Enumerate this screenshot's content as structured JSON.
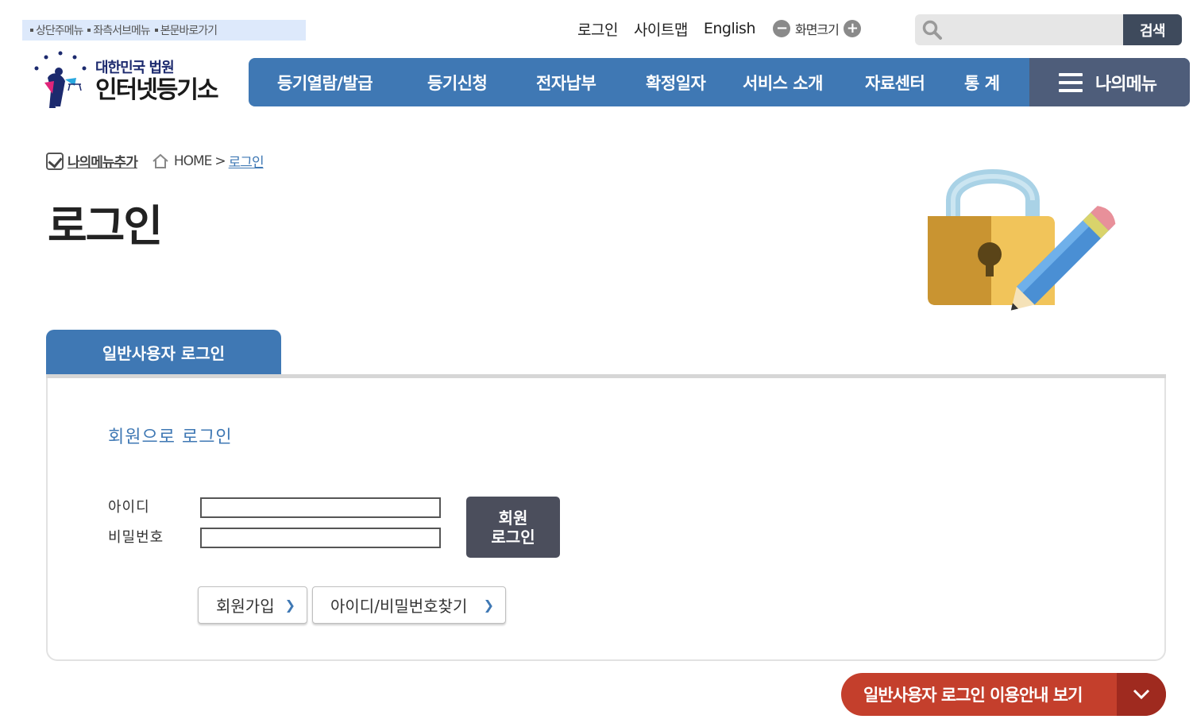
{
  "skip_links": [
    "상단주메뉴",
    "좌측서브메뉴",
    "본문바로가기"
  ],
  "util": {
    "login": "로그인",
    "sitemap": "사이트맵",
    "english": "English",
    "zoom_label": "화면크기",
    "zoom_out": "−",
    "zoom_in": "+"
  },
  "search": {
    "placeholder": "",
    "button": "검색"
  },
  "logo": {
    "sub": "대한민국 법원",
    "main": "인터넷등기소"
  },
  "gnb": {
    "items": [
      "등기열람/발급",
      "등기신청",
      "전자납부",
      "확정일자",
      "서비스 소개",
      "자료센터",
      "통 계"
    ],
    "my_menu": "나의메뉴"
  },
  "breadcrumb": {
    "add_my_menu": "나의메뉴추가",
    "home": "HOME",
    "sep": ">",
    "current": "로그인"
  },
  "page_title": "로그인",
  "tab": {
    "label": "일반사용자 로그인"
  },
  "form": {
    "section_title": "회원으로 로그인",
    "id_label": "아이디",
    "pw_label": "비밀번호",
    "id_value": "",
    "pw_value": "",
    "login_btn_line1": "회원",
    "login_btn_line2": "로그인",
    "join_btn": "회원가입",
    "find_btn": "아이디/비밀번호찾기"
  },
  "guide_button": "일반사용자 로그인 이용안내 보기",
  "colors": {
    "primary": "#3f78b4",
    "my_menu_bg": "#4e5d7a",
    "guide_red": "#c43f2c",
    "dark_btn": "#4b4e5c"
  }
}
